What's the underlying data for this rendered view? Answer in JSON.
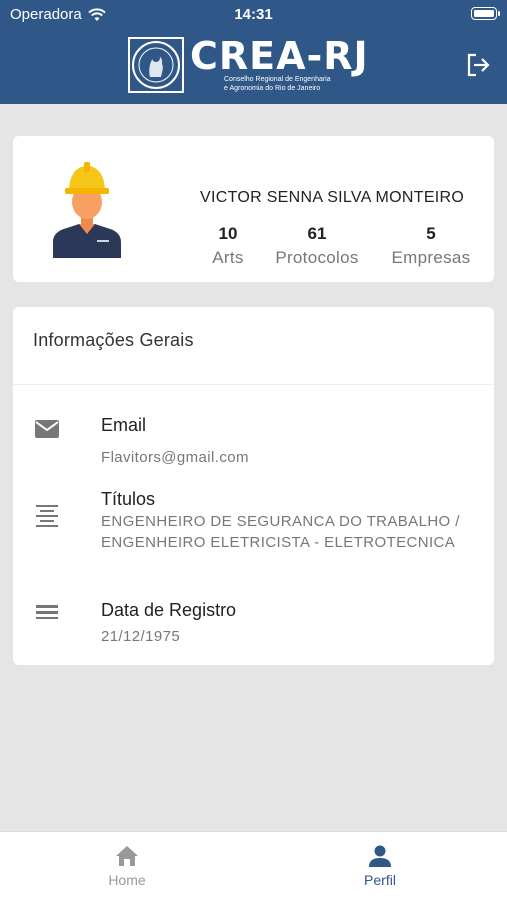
{
  "status_bar": {
    "carrier": "Operadora",
    "time": "14:31"
  },
  "header": {
    "brand_title": "CREA-RJ",
    "brand_subtitle_line1": "Conselho Regional de Engenharia",
    "brand_subtitle_line2": "e Agronomia do Rio de Janeiro",
    "logout_icon": "logout-icon"
  },
  "profile": {
    "name": "VICTOR SENNA SILVA MONTEIRO",
    "stats": [
      {
        "value": "10",
        "label": "Arts"
      },
      {
        "value": "61",
        "label": "Protocolos"
      },
      {
        "value": "5",
        "label": "Empresas"
      }
    ]
  },
  "info": {
    "title": "Informações Gerais",
    "rows": [
      {
        "icon": "email-icon",
        "label": "Email",
        "value": "Flavitors@gmail.com"
      },
      {
        "icon": "text-align-center-icon",
        "label": "Títulos",
        "value": "ENGENHEIRO DE SEGURANCA DO TRABALHO / ENGENHEIRO ELETRICISTA - ELETROTECNICA"
      },
      {
        "icon": "list-lines-icon",
        "label": "Data de Registro",
        "value": "21/12/1975"
      }
    ]
  },
  "bottom_nav": {
    "items": [
      {
        "label": "Home",
        "icon": "home-icon",
        "active": false
      },
      {
        "label": "Perfil",
        "icon": "person-icon",
        "active": true
      }
    ]
  },
  "colors": {
    "primary": "#2f5788",
    "background": "#e5e5e5",
    "helmet": "#f5c518"
  }
}
